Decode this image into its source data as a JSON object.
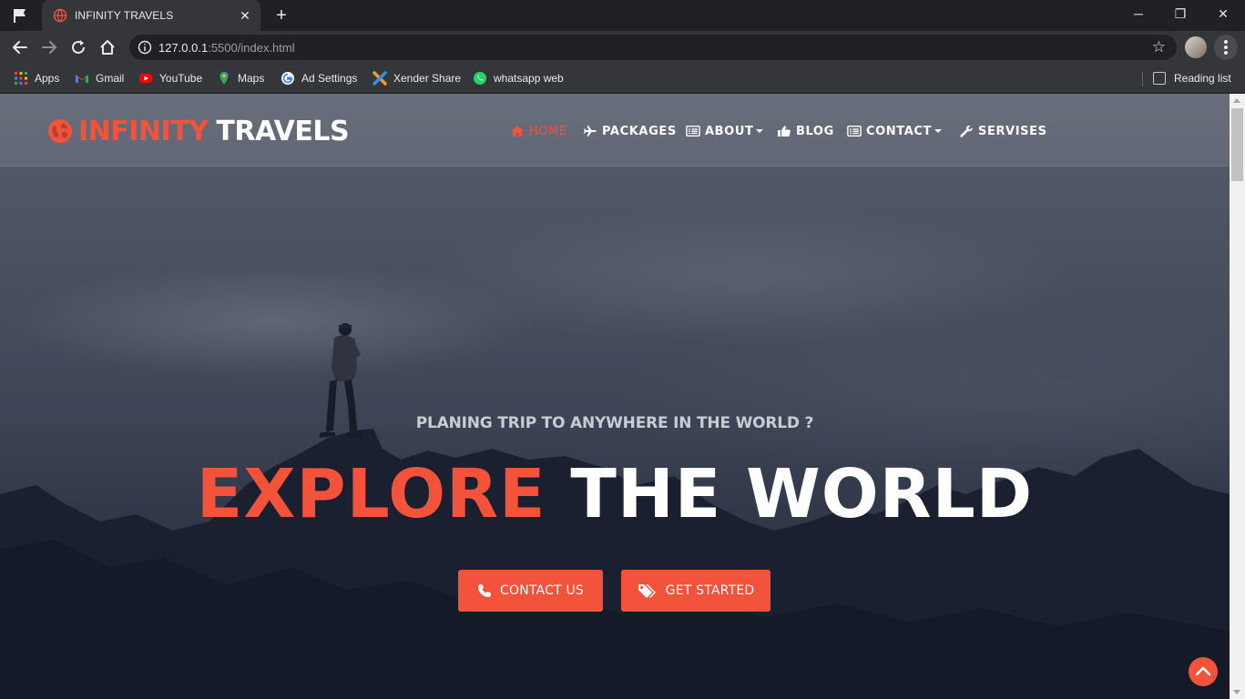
{
  "browser": {
    "tab_title": "INFINITY TRAVELS",
    "url_host": "127.0.0.1",
    "url_rest": ":5500/index.html",
    "bookmarks": [
      {
        "label": "Apps",
        "icon": "apps-grid-icon"
      },
      {
        "label": "Gmail",
        "icon": "gmail-icon"
      },
      {
        "label": "YouTube",
        "icon": "youtube-icon"
      },
      {
        "label": "Maps",
        "icon": "maps-icon"
      },
      {
        "label": "Ad Settings",
        "icon": "google-icon"
      },
      {
        "label": "Xender Share",
        "icon": "xender-icon"
      },
      {
        "label": "whatsapp web",
        "icon": "whatsapp-icon"
      }
    ],
    "reading_list": "Reading list"
  },
  "site": {
    "brand_part1": "INFINITY",
    "brand_part2": "TRAVELS",
    "nav": [
      {
        "label": "HOME",
        "icon": "home-icon",
        "active": true
      },
      {
        "label": "PACKAGES",
        "icon": "plane-icon"
      },
      {
        "label": "ABOUT",
        "icon": "list-icon",
        "dropdown": true
      },
      {
        "label": "BLOG",
        "icon": "thumbs-up-icon"
      },
      {
        "label": "CONTACT",
        "icon": "list-icon",
        "dropdown": true
      },
      {
        "label": "SERVISES",
        "icon": "wrench-icon"
      }
    ],
    "tagline": "PLANING TRIP TO ANYWHERE IN THE WORLD ?",
    "headline_accent": "EXPLORE",
    "headline_rest": "THE WORLD",
    "buttons": {
      "contact": "CONTACT US",
      "started": "GET STARTED"
    }
  },
  "colors": {
    "accent": "#f2533a",
    "chrome_dark": "#202124",
    "chrome_mid": "#35363a"
  }
}
